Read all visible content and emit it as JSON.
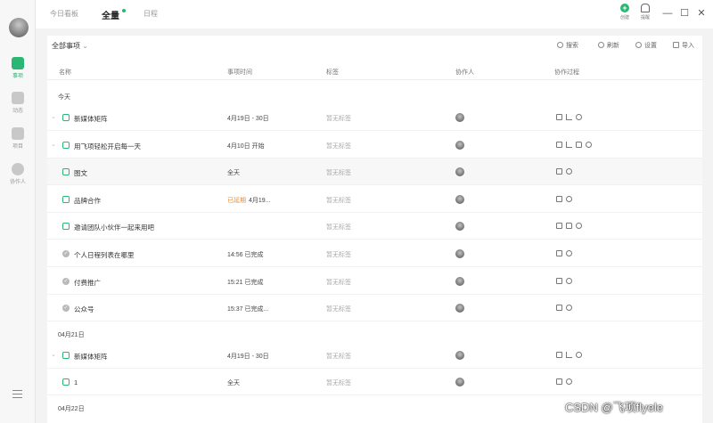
{
  "sidebar": {
    "items": [
      {
        "label": "事项",
        "icon": "calendar-check-icon",
        "active": true
      },
      {
        "label": "动态",
        "icon": "lightning-icon",
        "active": false
      },
      {
        "label": "项目",
        "icon": "folder-icon",
        "active": false
      },
      {
        "label": "协作人",
        "icon": "person-icon",
        "active": false
      }
    ],
    "menu_icon": "hamburger-icon"
  },
  "topbar": {
    "tabs": [
      {
        "label": "今日看板"
      },
      {
        "label": "全量"
      },
      {
        "label": "日程"
      }
    ],
    "actions": [
      {
        "label": "创建",
        "icon": "plus-icon"
      },
      {
        "label": "提醒",
        "icon": "bell-icon"
      }
    ],
    "window": {
      "minimize": "—",
      "maximize": "☐",
      "close": "✕"
    }
  },
  "filter": {
    "label": "全部事项"
  },
  "toolbar": [
    {
      "label": "搜索",
      "icon": "search-icon"
    },
    {
      "label": "刷新",
      "icon": "refresh-icon"
    },
    {
      "label": "设置",
      "icon": "gear-icon"
    },
    {
      "label": "导入",
      "icon": "import-icon"
    }
  ],
  "columns": [
    "名称",
    "事项时间",
    "标签",
    "协作人",
    "协作过程"
  ],
  "groups": [
    {
      "title": "今天",
      "rows": [
        {
          "name": "新媒体矩阵",
          "time": "4月19日 - 30日",
          "overdue": "",
          "tag": "暂无标签",
          "done": false,
          "expand": true,
          "process": [
            "doc",
            "tree",
            "chat"
          ]
        },
        {
          "name": "用飞项轻松开启每一天",
          "time": "4月10日 开始",
          "overdue": "",
          "tag": "暂无标签",
          "done": false,
          "expand": true,
          "process": [
            "doc",
            "tree",
            "folder",
            "chat"
          ]
        },
        {
          "name": "图文",
          "time": "全天",
          "overdue": "",
          "tag": "暂无标签",
          "done": false,
          "expand": false,
          "process": [
            "doc",
            "chat"
          ]
        },
        {
          "name": "品牌合作",
          "time": "4月19...",
          "overdue": "已延期",
          "tag": "暂无标签",
          "done": false,
          "expand": false,
          "process": [
            "doc",
            "chat"
          ]
        },
        {
          "name": "邀请团队小伙伴一起来用吧",
          "time": "",
          "overdue": "",
          "tag": "暂无标签",
          "done": false,
          "expand": false,
          "process": [
            "doc",
            "folder",
            "chat"
          ]
        },
        {
          "name": "个人日程列表在哪里",
          "time": "14:56 已完成",
          "overdue": "",
          "tag": "暂无标签",
          "done": true,
          "expand": false,
          "process": [
            "doc",
            "chat"
          ]
        },
        {
          "name": "付费推广",
          "time": "15:21 已完成",
          "overdue": "",
          "tag": "暂无标签",
          "done": true,
          "expand": false,
          "process": [
            "doc",
            "chat"
          ]
        },
        {
          "name": "公众号",
          "time": "15:37 已完成...",
          "overdue": "",
          "tag": "暂无标签",
          "done": true,
          "expand": false,
          "process": [
            "doc",
            "chat"
          ]
        }
      ]
    },
    {
      "title": "04月21日",
      "rows": [
        {
          "name": "新媒体矩阵",
          "time": "4月19日 - 30日",
          "overdue": "",
          "tag": "暂无标签",
          "done": false,
          "expand": true,
          "process": [
            "doc",
            "tree",
            "chat"
          ]
        },
        {
          "name": "1",
          "time": "全天",
          "overdue": "",
          "tag": "暂无标签",
          "done": false,
          "expand": false,
          "process": [
            "doc",
            "chat"
          ]
        }
      ]
    },
    {
      "title": "04月22日",
      "rows": []
    }
  ],
  "watermark": "CSDN @飞项flyele",
  "colors": {
    "accent": "#2bb673",
    "overdue": "#f08c2a"
  }
}
